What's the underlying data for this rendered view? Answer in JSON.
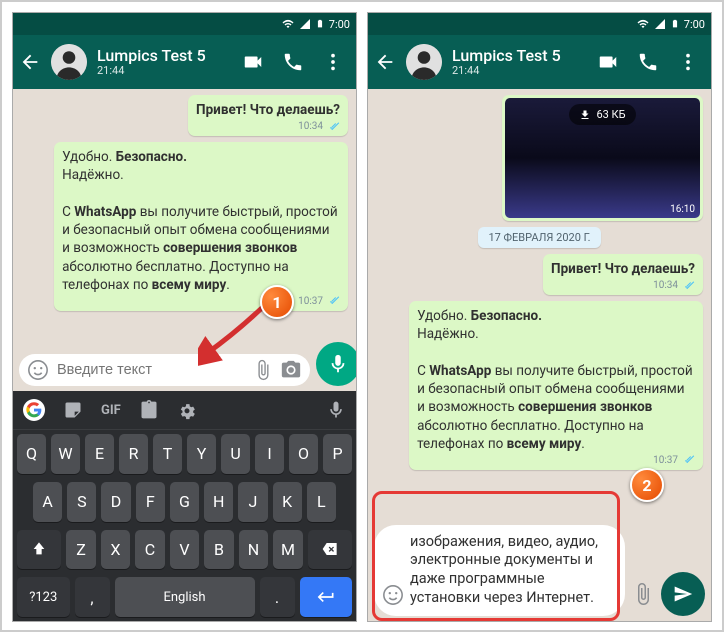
{
  "status": {
    "time": "7:00"
  },
  "header": {
    "name": "Lumpics Test 5",
    "time": "21:44"
  },
  "left": {
    "msg1": {
      "text": "Привет! Что делаешь?",
      "time": "10:34"
    },
    "msg2": {
      "line1a": "Удобно. ",
      "line1b": "Безопасно.",
      "line2": "Надёжно.",
      "p2_a": "С ",
      "p2_b": "WhatsApp",
      "p2_c": " вы получите быстрый, простой и безопасный опыт обмена сообщениями и возможность ",
      "p2_d": "совершения звонков",
      "p2_e": " абсолютно бесплатно. Доступно на телефонах по ",
      "p2_f": "всему миру",
      "p2_g": ".",
      "time": "10:37"
    },
    "input_placeholder": "Введите текст"
  },
  "right": {
    "image": {
      "size": "63 КБ",
      "time": "16:10"
    },
    "datechip": "17 ФЕВРАЛЯ 2020 Г.",
    "msg1": {
      "text": "Привет! Что делаешь?",
      "time": "10:34"
    },
    "msg2": {
      "line1a": "Удобно. ",
      "line1b": "Безопасно.",
      "line2": "Надёжно.",
      "p2_a": "С ",
      "p2_b": "WhatsApp",
      "p2_c": " вы получите быстрый, простой и безопасный опыт обмена сообщениями и возможность ",
      "p2_d": "совершения звонков",
      "p2_e": " абсолютно бесплатно. Доступно на телефонах по ",
      "p2_f": "всему миру",
      "p2_g": ".",
      "time": "10:37"
    },
    "compose": "изображения, видео, аудио, электронные документы и даже программные установки через Интернет."
  },
  "keyboard": {
    "gif": "GIF",
    "r1": [
      "Q",
      "W",
      "E",
      "R",
      "T",
      "Y",
      "U",
      "I",
      "O",
      "P"
    ],
    "r2": [
      "A",
      "S",
      "D",
      "F",
      "G",
      "H",
      "J",
      "K",
      "L"
    ],
    "r3": [
      "Z",
      "X",
      "C",
      "V",
      "B",
      "N",
      "M"
    ],
    "sym": "?123",
    "comma": ",",
    "space": "English",
    "dot": "."
  },
  "steps": {
    "s1": "1",
    "s2": "2"
  }
}
